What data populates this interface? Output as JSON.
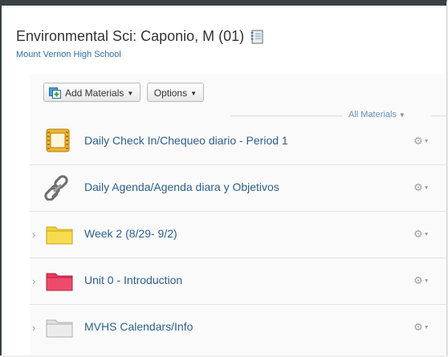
{
  "course": {
    "title": "Environmental Sci: Caponio, M (01)",
    "school": "Mount Vernon High School"
  },
  "toolbar": {
    "add_materials_label": "Add Materials",
    "options_label": "Options"
  },
  "filter": {
    "label": "All Materials"
  },
  "items": [
    {
      "title": "Daily Check In/Chequeo diario - Period 1",
      "type": "assignment",
      "icon": "assignment-icon"
    },
    {
      "title": "Daily Agenda/Agenda diara y Objetivos",
      "type": "link",
      "icon": "link-icon"
    },
    {
      "title": "Week 2 (8/29- 9/2)",
      "type": "folder",
      "icon": "folder-icon",
      "color": "#f5d337"
    },
    {
      "title": "Unit 0 - Introduction",
      "type": "folder",
      "icon": "folder-icon",
      "color": "#e8385c"
    },
    {
      "title": "MVHS Calendars/Info",
      "type": "folder",
      "icon": "folder-icon",
      "color": "#e6e6e6"
    }
  ],
  "colors": {
    "link": "#2d5f8b",
    "accent": "#2b6fa8"
  }
}
